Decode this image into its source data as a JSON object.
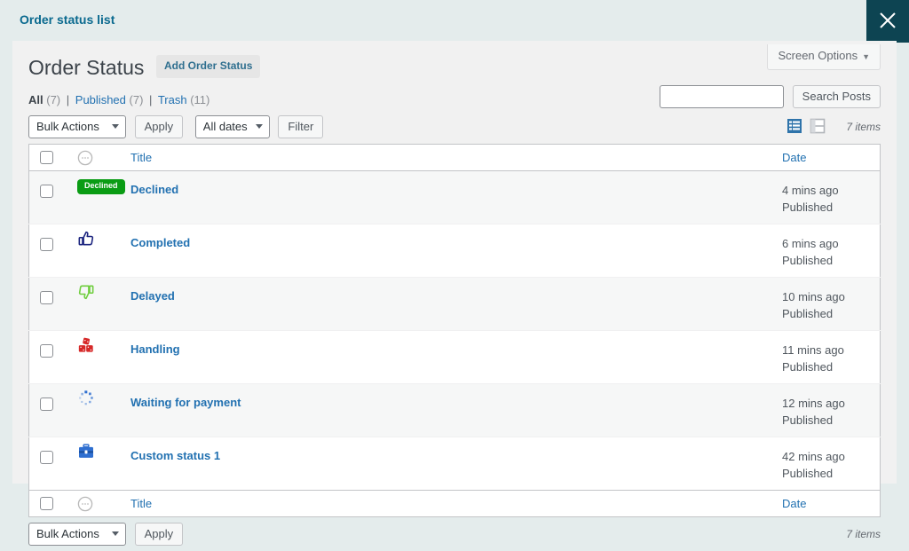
{
  "modal": {
    "title": "Order status list",
    "close_icon": "close-icon"
  },
  "screen_options": {
    "label": "Screen Options",
    "caret": "▼"
  },
  "page": {
    "heading": "Order Status",
    "add_button": "Add Order Status"
  },
  "status_links": [
    {
      "label": "All",
      "count": "(7)",
      "current": true
    },
    {
      "label": "Published",
      "count": "(7)",
      "current": false
    },
    {
      "label": "Trash",
      "count": "(11)",
      "current": false
    }
  ],
  "search": {
    "value": "",
    "placeholder": "",
    "button": "Search Posts"
  },
  "toolbar": {
    "bulk_actions": "Bulk Actions",
    "apply": "Apply",
    "all_dates": "All dates",
    "filter": "Filter",
    "items_count": "7 items",
    "list_view_icon": "list-view-icon",
    "excerpt_view_icon": "excerpt-view-icon"
  },
  "table": {
    "columns": {
      "title": "Title",
      "date": "Date"
    },
    "header_icon": "circle-dots-icon",
    "rows": [
      {
        "title": "Declined",
        "icon": "declined-badge",
        "badge_text": "Declined",
        "date_rel": "4 mins ago",
        "date_status": "Published"
      },
      {
        "title": "Completed",
        "icon": "thumbs-up-icon",
        "date_rel": "6 mins ago",
        "date_status": "Published"
      },
      {
        "title": "Delayed",
        "icon": "thumbs-down-icon",
        "date_rel": "10 mins ago",
        "date_status": "Published"
      },
      {
        "title": "Handling",
        "icon": "dice-icon",
        "date_rel": "11 mins ago",
        "date_status": "Published"
      },
      {
        "title": "Waiting for payment",
        "icon": "spinner-icon",
        "date_rel": "12 mins ago",
        "date_status": "Published"
      },
      {
        "title": "Custom status 1",
        "icon": "briefcase-icon",
        "date_rel": "42 mins ago",
        "date_status": "Published"
      }
    ]
  },
  "bottom_toolbar": {
    "bulk_actions": "Bulk Actions",
    "apply": "Apply",
    "items_count": "7 items"
  },
  "colors": {
    "accent_blue": "#2271b1",
    "badge_green": "#0a9c14",
    "close_bg": "#0d4452",
    "title_blue": "#0b6a8f"
  }
}
